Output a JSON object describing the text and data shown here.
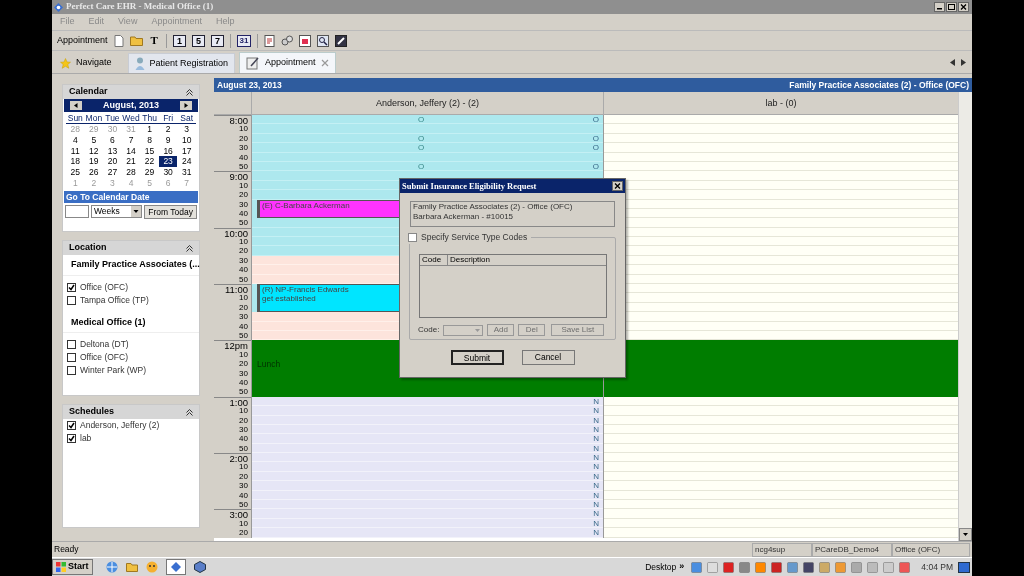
{
  "window": {
    "title": "Perfect Care EHR - Medical Office (1)"
  },
  "menu": [
    "File",
    "Edit",
    "View",
    "Appointment",
    "Help"
  ],
  "toolbar": {
    "label": "Appointment",
    "text_button": "T",
    "view_buttons": [
      "1",
      "5",
      "7"
    ],
    "month_button": "31"
  },
  "tabs": [
    {
      "label": "Navigate",
      "kind": "button",
      "selected": false,
      "closable": false
    },
    {
      "label": "Patient Registration",
      "kind": "tab",
      "selected": false,
      "closable": false
    },
    {
      "label": "Appointment",
      "kind": "tab",
      "selected": true,
      "closable": true
    }
  ],
  "calendar": {
    "title": "Calendar",
    "month": "August, 2013",
    "weekdays": [
      "Sun",
      "Mon",
      "Tue",
      "Wed",
      "Thu",
      "Fri",
      "Sat"
    ],
    "weeks": [
      [
        {
          "day": "28",
          "outside": true,
          "selected": false
        },
        {
          "day": "29",
          "outside": true,
          "selected": false
        },
        {
          "day": "30",
          "outside": true,
          "selected": false
        },
        {
          "day": "31",
          "outside": true,
          "selected": false
        },
        {
          "day": "1",
          "outside": false,
          "selected": false
        },
        {
          "day": "2",
          "outside": false,
          "selected": false
        },
        {
          "day": "3",
          "outside": false,
          "selected": false
        }
      ],
      [
        {
          "day": "4",
          "outside": false,
          "selected": false
        },
        {
          "day": "5",
          "outside": false,
          "selected": false
        },
        {
          "day": "6",
          "outside": false,
          "selected": false
        },
        {
          "day": "7",
          "outside": false,
          "selected": false
        },
        {
          "day": "8",
          "outside": false,
          "selected": false
        },
        {
          "day": "9",
          "outside": false,
          "selected": false
        },
        {
          "day": "10",
          "outside": false,
          "selected": false
        }
      ],
      [
        {
          "day": "11",
          "outside": false,
          "selected": false
        },
        {
          "day": "12",
          "outside": false,
          "selected": false
        },
        {
          "day": "13",
          "outside": false,
          "selected": false
        },
        {
          "day": "14",
          "outside": false,
          "selected": false
        },
        {
          "day": "15",
          "outside": false,
          "selected": false
        },
        {
          "day": "16",
          "outside": false,
          "selected": false
        },
        {
          "day": "17",
          "outside": false,
          "selected": false
        }
      ],
      [
        {
          "day": "18",
          "outside": false,
          "selected": false
        },
        {
          "day": "19",
          "outside": false,
          "selected": false
        },
        {
          "day": "20",
          "outside": false,
          "selected": false
        },
        {
          "day": "21",
          "outside": false,
          "selected": false
        },
        {
          "day": "22",
          "outside": false,
          "selected": false
        },
        {
          "day": "23",
          "outside": false,
          "selected": true
        },
        {
          "day": "24",
          "outside": false,
          "selected": false
        }
      ],
      [
        {
          "day": "25",
          "outside": false,
          "selected": false
        },
        {
          "day": "26",
          "outside": false,
          "selected": false
        },
        {
          "day": "27",
          "outside": false,
          "selected": false
        },
        {
          "day": "28",
          "outside": false,
          "selected": false
        },
        {
          "day": "29",
          "outside": false,
          "selected": false
        },
        {
          "day": "30",
          "outside": false,
          "selected": false
        },
        {
          "day": "31",
          "outside": false,
          "selected": false
        }
      ],
      [
        {
          "day": "1",
          "outside": true,
          "selected": false
        },
        {
          "day": "2",
          "outside": true,
          "selected": false
        },
        {
          "day": "3",
          "outside": true,
          "selected": false
        },
        {
          "day": "4",
          "outside": true,
          "selected": false
        },
        {
          "day": "5",
          "outside": true,
          "selected": false
        },
        {
          "day": "6",
          "outside": true,
          "selected": false
        },
        {
          "day": "7",
          "outside": true,
          "selected": false
        }
      ]
    ],
    "goto_title": "Go To Calendar Date",
    "unit": "Weeks",
    "goto_button": "From Today"
  },
  "location": {
    "title": "Location",
    "groups": [
      {
        "name": "Family Practice Associates (...",
        "items": [
          {
            "label": "Office (OFC)",
            "checked": true
          },
          {
            "label": "Tampa Office (TP)",
            "checked": false
          }
        ]
      },
      {
        "name": "Medical Office (1)",
        "items": [
          {
            "label": "Deltona (DT)",
            "checked": false
          },
          {
            "label": "Office (OFC)",
            "checked": false
          },
          {
            "label": "Winter Park (WP)",
            "checked": false
          }
        ]
      }
    ]
  },
  "schedules": {
    "title": "Schedules",
    "items": [
      {
        "label": "Anderson, Jeffery (2)",
        "checked": true
      },
      {
        "label": "lab",
        "checked": true
      }
    ]
  },
  "schedule": {
    "date": "August 23, 2013",
    "practice": "Family Practice Associates (2) - Office (OFC)",
    "columns": [
      "Anderson, Jeffery (2) - (2)",
      "lab - (0)"
    ],
    "slots": [
      {
        "time": "8:00",
        "hour": true,
        "provider": {
          "kind": "available"
        },
        "lab": {
          "kind": "open"
        },
        "marker_center": "O",
        "marker_right": "O"
      },
      {
        "time": "10",
        "hour": false,
        "provider": {
          "kind": "available"
        },
        "lab": {
          "kind": "open"
        }
      },
      {
        "time": "20",
        "hour": false,
        "provider": {
          "kind": "available"
        },
        "lab": {
          "kind": "open"
        },
        "marker_center": "O",
        "marker_right": "O"
      },
      {
        "time": "30",
        "hour": false,
        "provider": {
          "kind": "available"
        },
        "lab": {
          "kind": "open"
        },
        "marker_center": "O",
        "marker_right": "O"
      },
      {
        "time": "40",
        "hour": false,
        "provider": {
          "kind": "available"
        },
        "lab": {
          "kind": "open"
        }
      },
      {
        "time": "50",
        "hour": false,
        "provider": {
          "kind": "available"
        },
        "lab": {
          "kind": "open"
        },
        "marker_center": "O",
        "marker_right": "O"
      },
      {
        "time": "9:00",
        "hour": true,
        "provider": {
          "kind": "available"
        },
        "lab": {
          "kind": "open"
        }
      },
      {
        "time": "10",
        "hour": false,
        "provider": {
          "kind": "available"
        },
        "lab": {
          "kind": "open"
        }
      },
      {
        "time": "20",
        "hour": false,
        "provider": {
          "kind": "available"
        },
        "lab": {
          "kind": "open"
        }
      },
      {
        "time": "30",
        "hour": false,
        "provider": {
          "kind": "booked"
        },
        "lab": {
          "kind": "open"
        },
        "appointment": {
          "lines": [
            "(E) C-Barbara Ackerman"
          ],
          "color": "#ff33ff"
        }
      },
      {
        "time": "40",
        "hour": false,
        "provider": {
          "kind": "booked"
        },
        "lab": {
          "kind": "open"
        }
      },
      {
        "time": "50",
        "hour": false,
        "provider": {
          "kind": "available"
        },
        "lab": {
          "kind": "open"
        }
      },
      {
        "time": "10:00",
        "hour": true,
        "provider": {
          "kind": "available"
        },
        "lab": {
          "kind": "open"
        }
      },
      {
        "time": "10",
        "hour": false,
        "provider": {
          "kind": "available"
        },
        "lab": {
          "kind": "open"
        }
      },
      {
        "time": "20",
        "hour": false,
        "provider": {
          "kind": "available"
        },
        "lab": {
          "kind": "open"
        }
      },
      {
        "time": "30",
        "hour": false,
        "provider": {
          "kind": "unavailable"
        },
        "lab": {
          "kind": "open"
        }
      },
      {
        "time": "40",
        "hour": false,
        "provider": {
          "kind": "unavailable"
        },
        "lab": {
          "kind": "open"
        }
      },
      {
        "time": "50",
        "hour": false,
        "provider": {
          "kind": "unavailable"
        },
        "lab": {
          "kind": "open"
        }
      },
      {
        "time": "11:00",
        "hour": true,
        "provider": {
          "kind": "booked"
        },
        "lab": {
          "kind": "open"
        },
        "appointment": {
          "lines": [
            "(R) NP-Francis Edwards",
            "get established"
          ],
          "color": "#00e5ff"
        }
      },
      {
        "time": "10",
        "hour": false,
        "provider": {
          "kind": "booked"
        },
        "lab": {
          "kind": "open"
        }
      },
      {
        "time": "20",
        "hour": false,
        "provider": {
          "kind": "booked"
        },
        "lab": {
          "kind": "open"
        }
      },
      {
        "time": "30",
        "hour": false,
        "provider": {
          "kind": "unavailable"
        },
        "lab": {
          "kind": "open"
        }
      },
      {
        "time": "40",
        "hour": false,
        "provider": {
          "kind": "unavailable"
        },
        "lab": {
          "kind": "open"
        }
      },
      {
        "time": "50",
        "hour": false,
        "provider": {
          "kind": "unavailable"
        },
        "lab": {
          "kind": "open"
        }
      },
      {
        "time": "12pm",
        "hour": true,
        "provider": {
          "kind": "lunch"
        },
        "lab": {
          "kind": "lunch"
        }
      },
      {
        "time": "10",
        "hour": false,
        "provider": {
          "kind": "lunch"
        },
        "lab": {
          "kind": "lunch"
        }
      },
      {
        "time": "20",
        "hour": false,
        "provider": {
          "kind": "lunch"
        },
        "lab": {
          "kind": "lunch"
        },
        "note": "Lunch"
      },
      {
        "time": "30",
        "hour": false,
        "provider": {
          "kind": "lunch"
        },
        "lab": {
          "kind": "lunch"
        }
      },
      {
        "time": "40",
        "hour": false,
        "provider": {
          "kind": "lunch"
        },
        "lab": {
          "kind": "lunch"
        }
      },
      {
        "time": "50",
        "hour": false,
        "provider": {
          "kind": "lunch"
        },
        "lab": {
          "kind": "lunch"
        }
      },
      {
        "time": "1:00",
        "hour": true,
        "provider": {
          "kind": "closed"
        },
        "lab": {
          "kind": "open"
        },
        "marker_right": "N"
      },
      {
        "time": "10",
        "hour": false,
        "provider": {
          "kind": "closed"
        },
        "lab": {
          "kind": "open"
        },
        "marker_right": "N"
      },
      {
        "time": "20",
        "hour": false,
        "provider": {
          "kind": "closed"
        },
        "lab": {
          "kind": "open"
        },
        "marker_right": "N"
      },
      {
        "time": "30",
        "hour": false,
        "provider": {
          "kind": "closed"
        },
        "lab": {
          "kind": "open"
        },
        "marker_right": "N"
      },
      {
        "time": "40",
        "hour": false,
        "provider": {
          "kind": "closed"
        },
        "lab": {
          "kind": "open"
        },
        "marker_right": "N"
      },
      {
        "time": "50",
        "hour": false,
        "provider": {
          "kind": "closed"
        },
        "lab": {
          "kind": "open"
        },
        "marker_right": "N"
      },
      {
        "time": "2:00",
        "hour": true,
        "provider": {
          "kind": "closed"
        },
        "lab": {
          "kind": "open"
        },
        "marker_right": "N"
      },
      {
        "time": "10",
        "hour": false,
        "provider": {
          "kind": "closed"
        },
        "lab": {
          "kind": "open"
        },
        "marker_right": "N"
      },
      {
        "time": "20",
        "hour": false,
        "provider": {
          "kind": "closed"
        },
        "lab": {
          "kind": "open"
        },
        "marker_right": "N"
      },
      {
        "time": "30",
        "hour": false,
        "provider": {
          "kind": "closed"
        },
        "lab": {
          "kind": "open"
        },
        "marker_right": "N"
      },
      {
        "time": "40",
        "hour": false,
        "provider": {
          "kind": "closed"
        },
        "lab": {
          "kind": "open"
        },
        "marker_right": "N"
      },
      {
        "time": "50",
        "hour": false,
        "provider": {
          "kind": "closed"
        },
        "lab": {
          "kind": "open"
        },
        "marker_right": "N"
      },
      {
        "time": "3:00",
        "hour": true,
        "provider": {
          "kind": "closed"
        },
        "lab": {
          "kind": "open"
        },
        "marker_right": "N"
      },
      {
        "time": "10",
        "hour": false,
        "provider": {
          "kind": "closed"
        },
        "lab": {
          "kind": "open"
        },
        "marker_right": "N"
      },
      {
        "time": "20",
        "hour": false,
        "provider": {
          "kind": "closed"
        },
        "lab": {
          "kind": "open"
        },
        "marker_right": "N"
      }
    ]
  },
  "dialog": {
    "title": "Submit Insurance Eligibility Request",
    "info": [
      "Family Practice Associates (2) - Office (OFC)",
      "Barbara Ackerman - #10015"
    ],
    "specify": {
      "label": "Specify Service Type Codes",
      "checked": false
    },
    "table_columns": [
      "Code",
      "Description"
    ],
    "code_label": "Code:",
    "list_buttons": [
      {
        "label": "Add",
        "disabled": true
      },
      {
        "label": "Del",
        "disabled": true
      },
      {
        "label": "Save List",
        "disabled": true
      }
    ],
    "buttons": [
      "Submit",
      "Cancel"
    ]
  },
  "status_bar": {
    "message": "Ready",
    "panels": [
      "ncg4sup",
      "PCareDB_Demo4",
      "Office (OFC)"
    ]
  },
  "taskbar": {
    "start": "Start",
    "desktop": "Desktop",
    "chevron": "»",
    "clock": "4:04 PM"
  }
}
